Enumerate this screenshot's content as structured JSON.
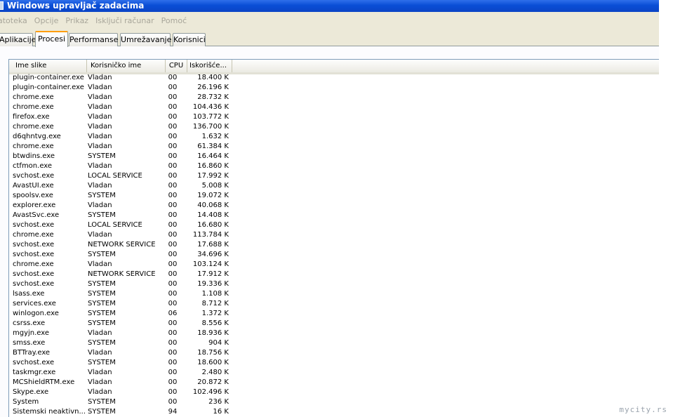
{
  "window": {
    "title": "Windows upravljač zadacima"
  },
  "menu": [
    "atoteka",
    "Opcije",
    "Prikaz",
    "Isključi računar",
    "Pomoć"
  ],
  "tabs": [
    {
      "label": "Aplikacije",
      "active": false
    },
    {
      "label": "Procesi",
      "active": true
    },
    {
      "label": "Performanse",
      "active": false
    },
    {
      "label": "Umrežavanje",
      "active": false
    },
    {
      "label": "Korisnici",
      "active": false
    }
  ],
  "columns": [
    "Ime slike",
    "Korisničko ime",
    "CPU",
    "Iskorišće..."
  ],
  "processes": [
    [
      "plugin-container.exe",
      "Vladan",
      "00",
      "18.400 K"
    ],
    [
      "plugin-container.exe",
      "Vladan",
      "00",
      "26.196 K"
    ],
    [
      "chrome.exe",
      "Vladan",
      "00",
      "28.732 K"
    ],
    [
      "chrome.exe",
      "Vladan",
      "00",
      "104.436 K"
    ],
    [
      "firefox.exe",
      "Vladan",
      "00",
      "103.772 K"
    ],
    [
      "chrome.exe",
      "Vladan",
      "00",
      "136.700 K"
    ],
    [
      "d6qhntvg.exe",
      "Vladan",
      "00",
      "1.632 K"
    ],
    [
      "chrome.exe",
      "Vladan",
      "00",
      "61.384 K"
    ],
    [
      "btwdins.exe",
      "SYSTEM",
      "00",
      "16.464 K"
    ],
    [
      "ctfmon.exe",
      "Vladan",
      "00",
      "16.860 K"
    ],
    [
      "svchost.exe",
      "LOCAL SERVICE",
      "00",
      "17.992 K"
    ],
    [
      "AvastUI.exe",
      "Vladan",
      "00",
      "5.008 K"
    ],
    [
      "spoolsv.exe",
      "SYSTEM",
      "00",
      "19.072 K"
    ],
    [
      "explorer.exe",
      "Vladan",
      "00",
      "40.068 K"
    ],
    [
      "AvastSvc.exe",
      "SYSTEM",
      "00",
      "14.408 K"
    ],
    [
      "svchost.exe",
      "LOCAL SERVICE",
      "00",
      "16.680 K"
    ],
    [
      "chrome.exe",
      "Vladan",
      "00",
      "113.784 K"
    ],
    [
      "svchost.exe",
      "NETWORK SERVICE",
      "00",
      "17.688 K"
    ],
    [
      "svchost.exe",
      "SYSTEM",
      "00",
      "34.696 K"
    ],
    [
      "chrome.exe",
      "Vladan",
      "00",
      "103.124 K"
    ],
    [
      "svchost.exe",
      "NETWORK SERVICE",
      "00",
      "17.912 K"
    ],
    [
      "svchost.exe",
      "SYSTEM",
      "00",
      "19.336 K"
    ],
    [
      "lsass.exe",
      "SYSTEM",
      "00",
      "1.108 K"
    ],
    [
      "services.exe",
      "SYSTEM",
      "00",
      "8.712 K"
    ],
    [
      "winlogon.exe",
      "SYSTEM",
      "06",
      "1.372 K"
    ],
    [
      "csrss.exe",
      "SYSTEM",
      "00",
      "8.556 K"
    ],
    [
      "mgyjn.exe",
      "Vladan",
      "00",
      "18.936 K"
    ],
    [
      "smss.exe",
      "SYSTEM",
      "00",
      "904 K"
    ],
    [
      "BTTray.exe",
      "Vladan",
      "00",
      "18.756 K"
    ],
    [
      "svchost.exe",
      "SYSTEM",
      "00",
      "18.600 K"
    ],
    [
      "taskmgr.exe",
      "Vladan",
      "00",
      "2.480 K"
    ],
    [
      "MCShieldRTM.exe",
      "Vladan",
      "00",
      "20.872 K"
    ],
    [
      "Skype.exe",
      "Vladan",
      "00",
      "102.496 K"
    ],
    [
      "System",
      "SYSTEM",
      "00",
      "236 K"
    ],
    [
      "Sistemski neaktivn...",
      "SYSTEM",
      "94",
      "16 K"
    ]
  ],
  "watermark": "mycity.rs"
}
